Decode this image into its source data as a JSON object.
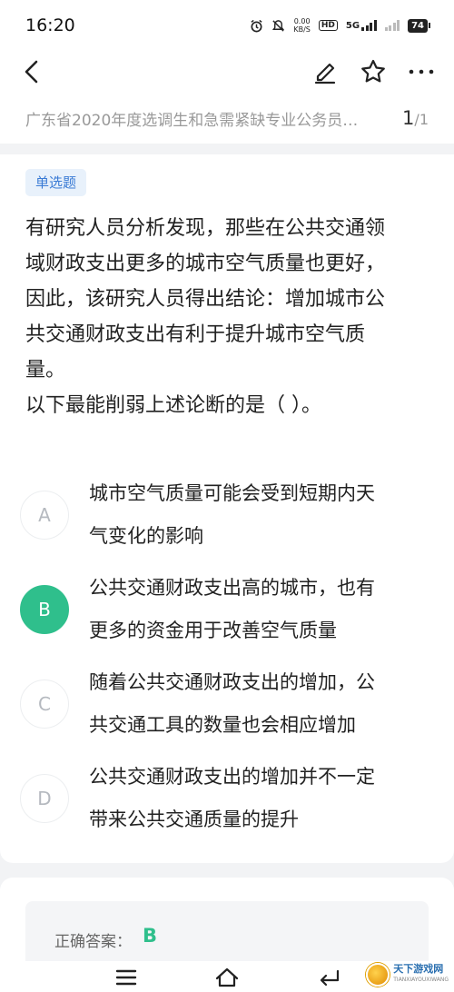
{
  "status_bar": {
    "time": "16:20",
    "network_speed": "0.00",
    "network_unit": "KB/S",
    "hd_label": "HD",
    "net_type": "5G",
    "battery": "74",
    "icons": [
      "alarm-icon",
      "mute-icon"
    ]
  },
  "nav": {
    "icons": [
      "back-icon",
      "edit-icon",
      "star-icon",
      "more-icon"
    ]
  },
  "paper": {
    "title": "广东省2020年度选调生和急需紧缺专业公务员…",
    "current_page": "1",
    "total_page": "/1"
  },
  "question": {
    "type": "单选题",
    "stem_lines": [
      "有研究人员分析发现，那些在公共交通领",
      "域财政支出更多的城市空气质量也更好，",
      "因此，该研究人员得出结论：增加城市公",
      "共交通财政支出有利于提升城市空气质",
      "量。",
      "以下最能削弱上述论断的是（    ）。"
    ],
    "options": [
      {
        "letter": "A",
        "lines": [
          "城市空气质量可能会受到短期内天",
          "气变化的影响"
        ],
        "selected": false
      },
      {
        "letter": "B",
        "lines": [
          "公共交通财政支出高的城市，也有",
          "更多的资金用于改善空气质量"
        ],
        "selected": true
      },
      {
        "letter": "C",
        "lines": [
          "随着公共交通财政支出的增加，公",
          "共交通工具的数量也会相应增加"
        ],
        "selected": false
      },
      {
        "letter": "D",
        "lines": [
          "公共交通财政支出的增加并不一定",
          "带来公共交通质量的提升"
        ],
        "selected": false
      }
    ]
  },
  "answer": {
    "label": "正确答案：",
    "value": "B"
  },
  "watermark": {
    "name": "天下游戏网",
    "sub": "TIANXIAYOUXIWANG"
  },
  "colors": {
    "accent": "#2fbf8c",
    "badge_bg": "#e8f1fb",
    "badge_text": "#3a7bd5"
  }
}
